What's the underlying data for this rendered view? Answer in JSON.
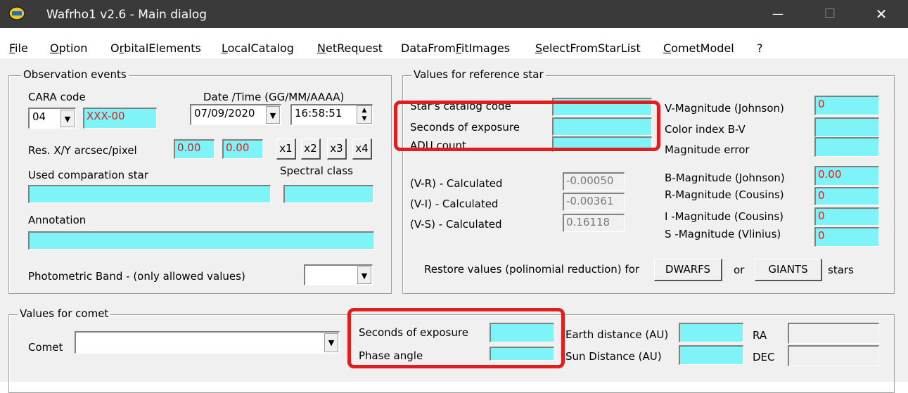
{
  "window": {
    "title": "Wafrho1 v2.6 - Main dialog",
    "minimize": "—",
    "maximize": "☐",
    "close": "✕"
  },
  "menu": [
    {
      "pre": "",
      "u": "F",
      "post": "ile"
    },
    {
      "pre": "",
      "u": "O",
      "post": "ption"
    },
    {
      "pre": "O",
      "u": "r",
      "post": "bitalElements"
    },
    {
      "pre": "",
      "u": "L",
      "post": "ocalCatalog"
    },
    {
      "pre": "",
      "u": "N",
      "post": "etRequest"
    },
    {
      "pre": "DataFrom",
      "u": "F",
      "post": "itImages"
    },
    {
      "pre": "",
      "u": "S",
      "post": "electFromStarList"
    },
    {
      "pre": "",
      "u": "C",
      "post": "ometModel"
    },
    {
      "pre": "?",
      "u": "",
      "post": ""
    }
  ],
  "observation": {
    "legend": "Observation events",
    "cara_code_label": "CARA code",
    "cara_code_value": "04",
    "cara_id_value": "XXX-00",
    "datetime_label": "Date /Time  (GG/MM/AAAA)",
    "date_value": "07/09/2020",
    "time_value": "16:58:51",
    "res_label": "Res. X/Y arcsec/pixel",
    "res_x": "0.00",
    "res_y": "0.00",
    "x_buttons": [
      "x1",
      "x2",
      "x3",
      "x4"
    ],
    "comparison_label": "Used comparation star",
    "spectral_label": "Spectral class",
    "annotation_label": "Annotation",
    "band_label": "Photometric Band  - (only allowed values)",
    "band_value": ""
  },
  "reference": {
    "legend": "Values for reference star",
    "catalog_label": "Star's catalog code",
    "exposure_label": "Seconds of exposure",
    "adu_label": "ADU count",
    "vr_label": "(V-R) - Calculated",
    "vi_label": "(V-I) -  Calculated",
    "vs_label": "(V-S) - Calculated",
    "vr_value": "-0.00050",
    "vi_value": "-0.00361",
    "vs_value": "0.16118",
    "vmag_label": "V-Magnitude (Johnson)",
    "vmag_value": "0",
    "bv_label": "Color index B-V",
    "magerr_label": "Magnitude error",
    "bmag_label": "B-Magnitude (Johnson)",
    "bmag_value": "0.00",
    "rmag_label": "R-Magnitude (Cousins)",
    "rmag_value": "0",
    "imag_label": "I -Magnitude (Cousins)",
    "imag_value": "0",
    "smag_label": "S -Magnitude (Vlinius)",
    "smag_value": "0",
    "restore_label": "Restore values (polinomial reduction) for",
    "dwarfs_label": "DWARFS",
    "or_label": "or",
    "giants_label": "GIANTS",
    "stars_label": "stars"
  },
  "comet": {
    "legend": "Values for comet",
    "comet_label": "Comet",
    "comet_value": "",
    "exposure_label": "Seconds of exposure",
    "phase_label": "Phase angle",
    "earth_label": "Earth distance (AU)",
    "sun_label": "Sun Distance (AU)",
    "ra_label": "RA",
    "dec_label": "DEC"
  },
  "colors": {
    "field": "#7ff4f8",
    "field_text": "#e01a1a",
    "highlight": "#e11d1d",
    "titlebar": "#3a3a3a"
  }
}
